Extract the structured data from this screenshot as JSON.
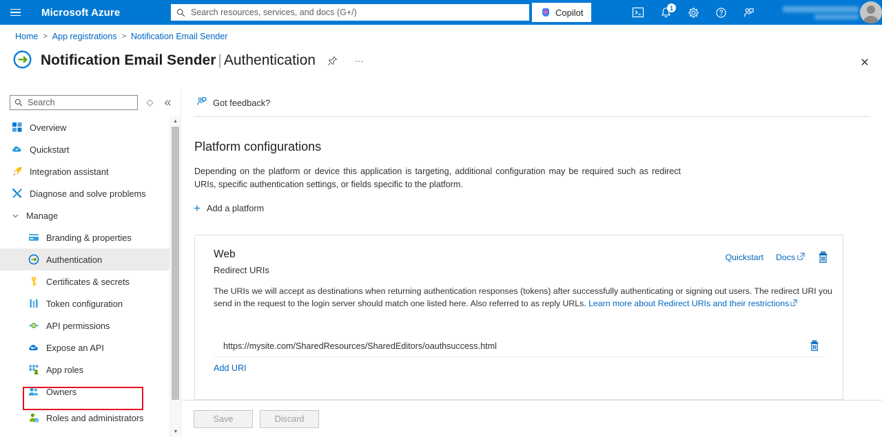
{
  "topbar": {
    "brand": "Microsoft Azure",
    "menu_icon": "hamburger-icon",
    "search_placeholder": "Search resources, services, and docs (G+/)",
    "search_value": "",
    "copilot_label": "Copilot",
    "icons": [
      {
        "name": "cloud-shell-icon",
        "glyph": ">_"
      },
      {
        "name": "notifications-bell-icon",
        "badge": "1"
      },
      {
        "name": "settings-gear-icon"
      },
      {
        "name": "help-question-icon"
      },
      {
        "name": "feedback-person-icon"
      }
    ],
    "account_name_redacted": true
  },
  "breadcrumb": {
    "items": [
      "Home",
      "App registrations",
      "Notification Email Sender"
    ],
    "separator": ">"
  },
  "page": {
    "title_main": "Notification Email Sender",
    "title_divider": "|",
    "title_sub": "Authentication",
    "pin_label": "Pin",
    "more_label": "···",
    "close_label": "✕"
  },
  "sidebar": {
    "search_placeholder": "Search",
    "search_value": "",
    "refresh_icon": "diamond-refresh-icon",
    "collapse_icon": "double-chevron-left-icon",
    "items": [
      {
        "label": "Overview",
        "icon": "grid-overview-icon",
        "indent": false,
        "active": false,
        "highlighted": false
      },
      {
        "label": "Quickstart",
        "icon": "quickstart-cloud-icon",
        "indent": false,
        "active": false,
        "highlighted": false
      },
      {
        "label": "Integration assistant",
        "icon": "rocket-icon",
        "indent": false,
        "active": false,
        "highlighted": false
      },
      {
        "label": "Diagnose and solve problems",
        "icon": "wrench-cross-icon",
        "indent": false,
        "active": false,
        "highlighted": false
      }
    ],
    "group_manage": {
      "label": "Manage",
      "expanded": true,
      "chevron": "chevron-down-icon"
    },
    "manage_items": [
      {
        "label": "Branding & properties",
        "icon": "branding-card-icon",
        "active": false,
        "highlighted": false
      },
      {
        "label": "Authentication",
        "icon": "authentication-arrow-icon",
        "active": true,
        "highlighted": false
      },
      {
        "label": "Certificates & secrets",
        "icon": "key-icon",
        "active": false,
        "highlighted": true
      },
      {
        "label": "Token configuration",
        "icon": "token-bars-icon",
        "active": false,
        "highlighted": false
      },
      {
        "label": "API permissions",
        "icon": "api-permissions-icon",
        "active": false,
        "highlighted": false
      },
      {
        "label": "Expose an API",
        "icon": "expose-api-cloud-icon",
        "active": false,
        "highlighted": false
      },
      {
        "label": "App roles",
        "icon": "app-roles-icon",
        "active": false,
        "highlighted": false
      },
      {
        "label": "Owners",
        "icon": "owners-people-icon",
        "active": false,
        "highlighted": false
      },
      {
        "label": "Roles and administrators",
        "icon": "roles-admin-person-icon",
        "active": false,
        "highlighted": false
      }
    ],
    "highlight_color": "#e81123",
    "scrollbar": {
      "up_arrow": "▲",
      "down_arrow": "▼"
    }
  },
  "command_bar": {
    "feedback_label": "Got feedback?",
    "feedback_icon": "feedback-person-icon"
  },
  "main": {
    "section_title": "Platform configurations",
    "section_description": "Depending on the platform or device this application is targeting, additional configuration may be required such as redirect URIs, specific authentication settings, or fields specific to the platform.",
    "add_platform_label": "Add a platform",
    "add_platform_icon": "plus-icon",
    "platform_card": {
      "title": "Web",
      "subtitle": "Redirect URIs",
      "quickstart_label": "Quickstart",
      "docs_label": "Docs",
      "docs_icon": "external-link-icon",
      "delete_icon": "trash-icon",
      "description_part1": "The URIs we will accept as destinations when returning authentication responses (tokens) after successfully authenticating or signing out users. The redirect URI you send in the request to the login server should match one listed here. Also referred to as reply URLs. ",
      "description_link": "Learn more about Redirect URIs and their restrictions",
      "redirect_uris": [
        {
          "value": "https://mysite.com/SharedResources/SharedEditors/oauthsuccess.html",
          "delete_icon": "trash-icon"
        }
      ],
      "add_uri_label": "Add URI"
    }
  },
  "footer": {
    "save_label": "Save",
    "discard_label": "Discard",
    "save_enabled": false,
    "discard_enabled": false
  },
  "colors": {
    "azure_blue": "#0078d4",
    "link_blue": "#0066c0",
    "highlight_red": "#e81123",
    "active_nav_bg": "#edebe9"
  }
}
